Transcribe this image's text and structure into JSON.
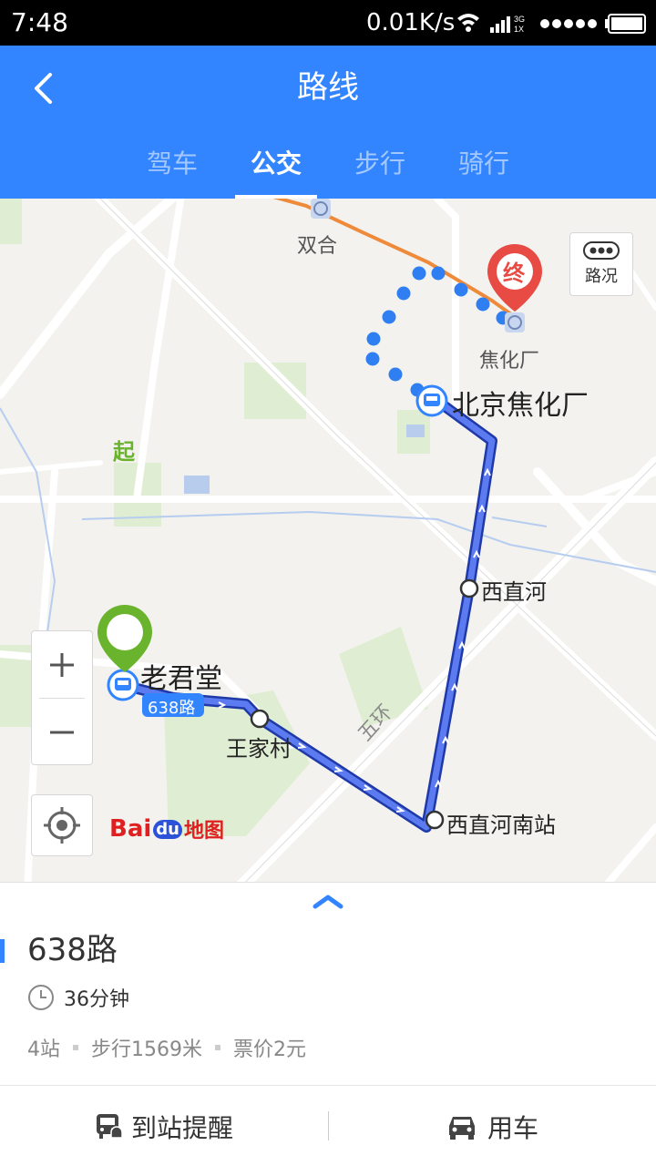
{
  "status_bar": {
    "time": "7:48",
    "network_speed": "0.01K/s"
  },
  "header": {
    "title": "路线",
    "tabs": [
      {
        "label": "驾车",
        "active": false
      },
      {
        "label": "公交",
        "active": true
      },
      {
        "label": "步行",
        "active": false
      },
      {
        "label": "骑行",
        "active": false
      }
    ]
  },
  "map": {
    "traffic_button_label": "路况",
    "start_marker": "起",
    "end_marker": "终",
    "stations": {
      "start": "老君堂",
      "end_stop": "北京焦化厂",
      "stop_1": "王家村",
      "stop_2": "西直河南站",
      "stop_3": "西直河",
      "subway_1": "双合",
      "subway_2": "焦化厂"
    },
    "road_label": "五环",
    "route_badge": "638路",
    "logo_text_bai": "Bai",
    "logo_text_du": "du",
    "logo_text_ditu": "地图",
    "colors": {
      "route": "#3a5ce6",
      "walk_dots": "#2f7ff2",
      "subway_line": "#ee8a3a",
      "start_pin": "#6ab42d",
      "end_pin": "#e84a44"
    }
  },
  "panel": {
    "route_name": "638路",
    "duration": "36分钟",
    "stops": "4站",
    "walk": "步行1569米",
    "fare": "票价2元",
    "actions": {
      "arrival_alert": "到站提醒",
      "car": "用车"
    }
  }
}
